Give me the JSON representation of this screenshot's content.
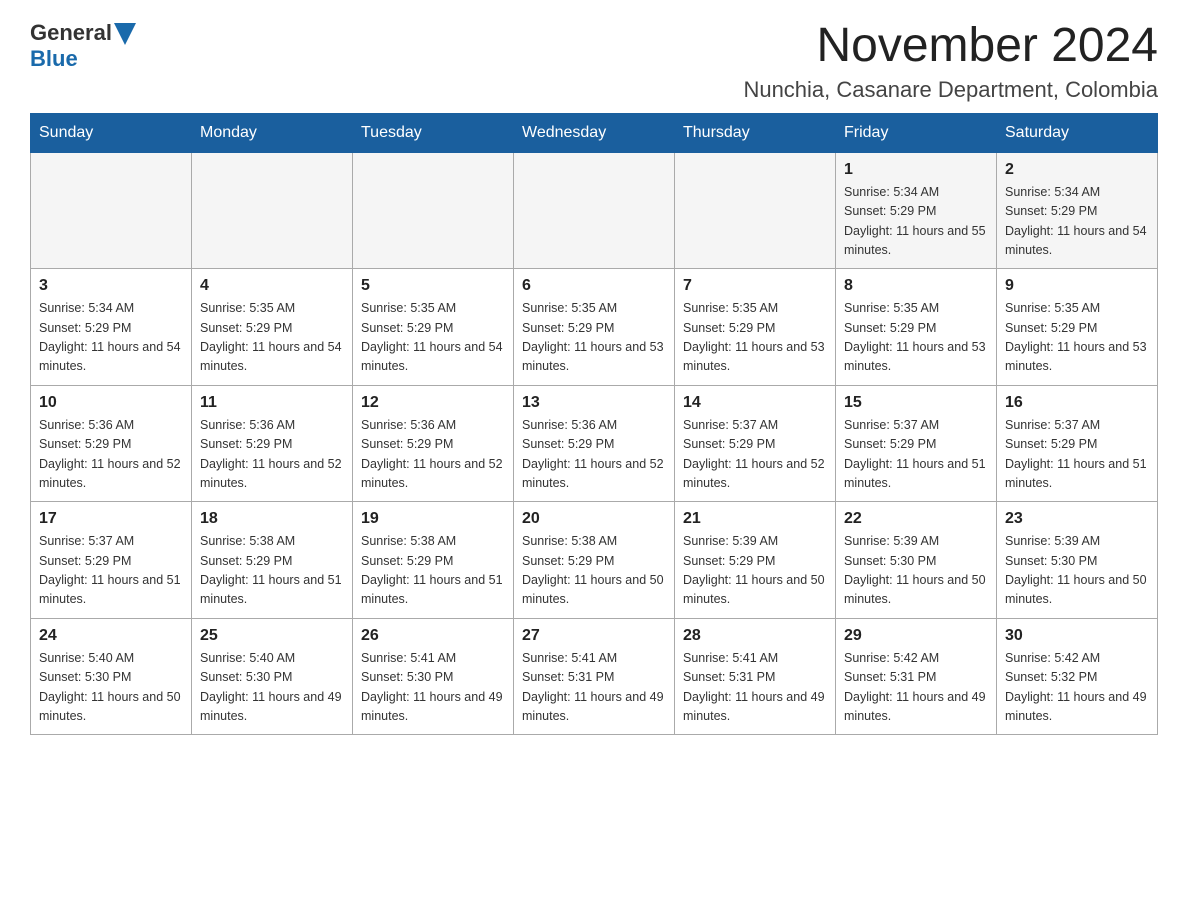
{
  "header": {
    "logo_general": "General",
    "logo_blue": "Blue",
    "month_title": "November 2024",
    "location": "Nunchia, Casanare Department, Colombia"
  },
  "days_of_week": [
    "Sunday",
    "Monday",
    "Tuesday",
    "Wednesday",
    "Thursday",
    "Friday",
    "Saturday"
  ],
  "weeks": [
    [
      {
        "day": "",
        "info": ""
      },
      {
        "day": "",
        "info": ""
      },
      {
        "day": "",
        "info": ""
      },
      {
        "day": "",
        "info": ""
      },
      {
        "day": "",
        "info": ""
      },
      {
        "day": "1",
        "info": "Sunrise: 5:34 AM\nSunset: 5:29 PM\nDaylight: 11 hours and 55 minutes."
      },
      {
        "day": "2",
        "info": "Sunrise: 5:34 AM\nSunset: 5:29 PM\nDaylight: 11 hours and 54 minutes."
      }
    ],
    [
      {
        "day": "3",
        "info": "Sunrise: 5:34 AM\nSunset: 5:29 PM\nDaylight: 11 hours and 54 minutes."
      },
      {
        "day": "4",
        "info": "Sunrise: 5:35 AM\nSunset: 5:29 PM\nDaylight: 11 hours and 54 minutes."
      },
      {
        "day": "5",
        "info": "Sunrise: 5:35 AM\nSunset: 5:29 PM\nDaylight: 11 hours and 54 minutes."
      },
      {
        "day": "6",
        "info": "Sunrise: 5:35 AM\nSunset: 5:29 PM\nDaylight: 11 hours and 53 minutes."
      },
      {
        "day": "7",
        "info": "Sunrise: 5:35 AM\nSunset: 5:29 PM\nDaylight: 11 hours and 53 minutes."
      },
      {
        "day": "8",
        "info": "Sunrise: 5:35 AM\nSunset: 5:29 PM\nDaylight: 11 hours and 53 minutes."
      },
      {
        "day": "9",
        "info": "Sunrise: 5:35 AM\nSunset: 5:29 PM\nDaylight: 11 hours and 53 minutes."
      }
    ],
    [
      {
        "day": "10",
        "info": "Sunrise: 5:36 AM\nSunset: 5:29 PM\nDaylight: 11 hours and 52 minutes."
      },
      {
        "day": "11",
        "info": "Sunrise: 5:36 AM\nSunset: 5:29 PM\nDaylight: 11 hours and 52 minutes."
      },
      {
        "day": "12",
        "info": "Sunrise: 5:36 AM\nSunset: 5:29 PM\nDaylight: 11 hours and 52 minutes."
      },
      {
        "day": "13",
        "info": "Sunrise: 5:36 AM\nSunset: 5:29 PM\nDaylight: 11 hours and 52 minutes."
      },
      {
        "day": "14",
        "info": "Sunrise: 5:37 AM\nSunset: 5:29 PM\nDaylight: 11 hours and 52 minutes."
      },
      {
        "day": "15",
        "info": "Sunrise: 5:37 AM\nSunset: 5:29 PM\nDaylight: 11 hours and 51 minutes."
      },
      {
        "day": "16",
        "info": "Sunrise: 5:37 AM\nSunset: 5:29 PM\nDaylight: 11 hours and 51 minutes."
      }
    ],
    [
      {
        "day": "17",
        "info": "Sunrise: 5:37 AM\nSunset: 5:29 PM\nDaylight: 11 hours and 51 minutes."
      },
      {
        "day": "18",
        "info": "Sunrise: 5:38 AM\nSunset: 5:29 PM\nDaylight: 11 hours and 51 minutes."
      },
      {
        "day": "19",
        "info": "Sunrise: 5:38 AM\nSunset: 5:29 PM\nDaylight: 11 hours and 51 minutes."
      },
      {
        "day": "20",
        "info": "Sunrise: 5:38 AM\nSunset: 5:29 PM\nDaylight: 11 hours and 50 minutes."
      },
      {
        "day": "21",
        "info": "Sunrise: 5:39 AM\nSunset: 5:29 PM\nDaylight: 11 hours and 50 minutes."
      },
      {
        "day": "22",
        "info": "Sunrise: 5:39 AM\nSunset: 5:30 PM\nDaylight: 11 hours and 50 minutes."
      },
      {
        "day": "23",
        "info": "Sunrise: 5:39 AM\nSunset: 5:30 PM\nDaylight: 11 hours and 50 minutes."
      }
    ],
    [
      {
        "day": "24",
        "info": "Sunrise: 5:40 AM\nSunset: 5:30 PM\nDaylight: 11 hours and 50 minutes."
      },
      {
        "day": "25",
        "info": "Sunrise: 5:40 AM\nSunset: 5:30 PM\nDaylight: 11 hours and 49 minutes."
      },
      {
        "day": "26",
        "info": "Sunrise: 5:41 AM\nSunset: 5:30 PM\nDaylight: 11 hours and 49 minutes."
      },
      {
        "day": "27",
        "info": "Sunrise: 5:41 AM\nSunset: 5:31 PM\nDaylight: 11 hours and 49 minutes."
      },
      {
        "day": "28",
        "info": "Sunrise: 5:41 AM\nSunset: 5:31 PM\nDaylight: 11 hours and 49 minutes."
      },
      {
        "day": "29",
        "info": "Sunrise: 5:42 AM\nSunset: 5:31 PM\nDaylight: 11 hours and 49 minutes."
      },
      {
        "day": "30",
        "info": "Sunrise: 5:42 AM\nSunset: 5:32 PM\nDaylight: 11 hours and 49 minutes."
      }
    ]
  ]
}
